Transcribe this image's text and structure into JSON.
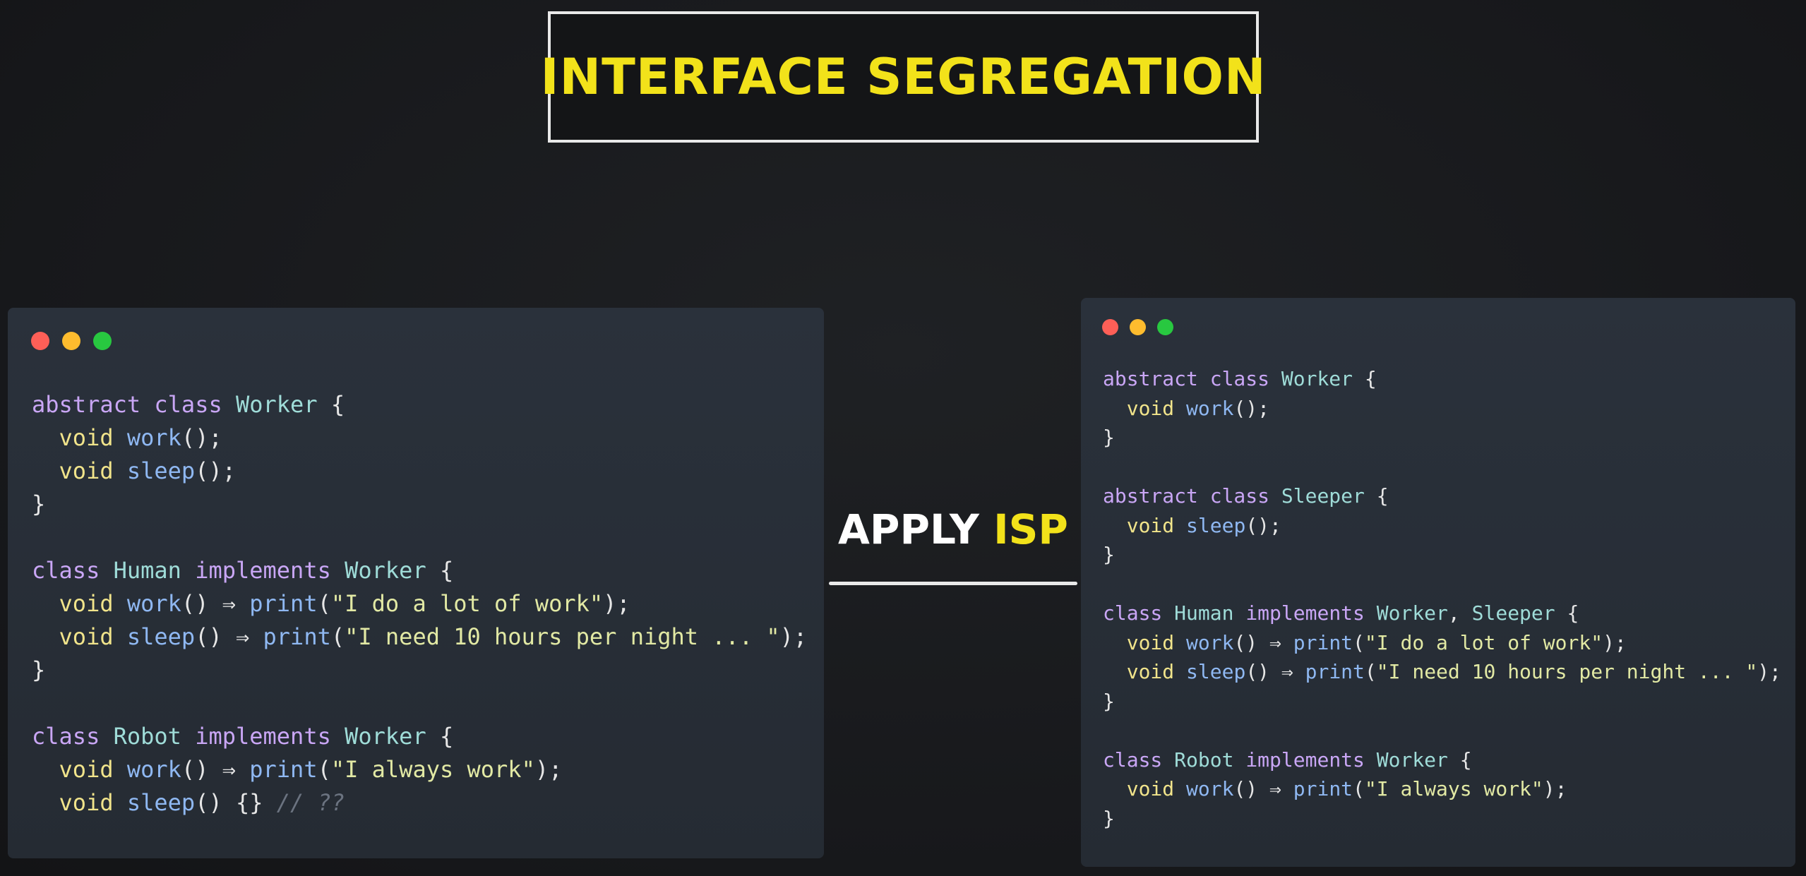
{
  "title": "INTERFACE SEGREGATION",
  "arrow": {
    "label_prefix": "APPLY",
    "label_highlight": "ISP"
  },
  "colors": {
    "title_yellow": "#f2e21a",
    "window_bg": "#2a313b",
    "dot_red": "#fe5f57",
    "dot_yellow": "#febc2e",
    "dot_green": "#28c840"
  },
  "left_code": {
    "l1": [
      "abstract",
      "class",
      "Worker",
      "{"
    ],
    "l2": [
      "void",
      "work",
      "();"
    ],
    "l3": [
      "void",
      "sleep",
      "();"
    ],
    "l4": "}",
    "l6": [
      "class",
      "Human",
      "implements",
      "Worker",
      "{"
    ],
    "l7": [
      "void",
      "work",
      "() ⇒",
      "print",
      "(",
      "\"I do a lot of work\"",
      ");"
    ],
    "l8": [
      "void",
      "sleep",
      "() ⇒",
      "print",
      "(",
      "\"I need 10 hours per night ... \"",
      ");"
    ],
    "l9": "}",
    "l11": [
      "class",
      "Robot",
      "implements",
      "Worker",
      "{"
    ],
    "l12": [
      "void",
      "work",
      "() ⇒",
      "print",
      "(",
      "\"I always work\"",
      ");"
    ],
    "l13": [
      "void",
      "sleep",
      "() {}",
      "// ??"
    ]
  },
  "right_code": {
    "l1": [
      "abstract",
      "class",
      "Worker",
      "{"
    ],
    "l2": [
      "void",
      "work",
      "();"
    ],
    "l3": "}",
    "l5": [
      "abstract",
      "class",
      "Sleeper",
      "{"
    ],
    "l6": [
      "void",
      "sleep",
      "();"
    ],
    "l7": "}",
    "l9": [
      "class",
      "Human",
      "implements",
      "Worker",
      ",",
      "Sleeper",
      "{"
    ],
    "l10": [
      "void",
      "work",
      "() ⇒",
      "print",
      "(",
      "\"I do a lot of work\"",
      ");"
    ],
    "l11": [
      "void",
      "sleep",
      "() ⇒",
      "print",
      "(",
      "\"I need 10 hours per night ... \"",
      ");"
    ],
    "l12": "}",
    "l14": [
      "class",
      "Robot",
      "implements",
      "Worker",
      "{"
    ],
    "l15": [
      "void",
      "work",
      "() ⇒",
      "print",
      "(",
      "\"I always work\"",
      ");"
    ],
    "l16": "}"
  }
}
